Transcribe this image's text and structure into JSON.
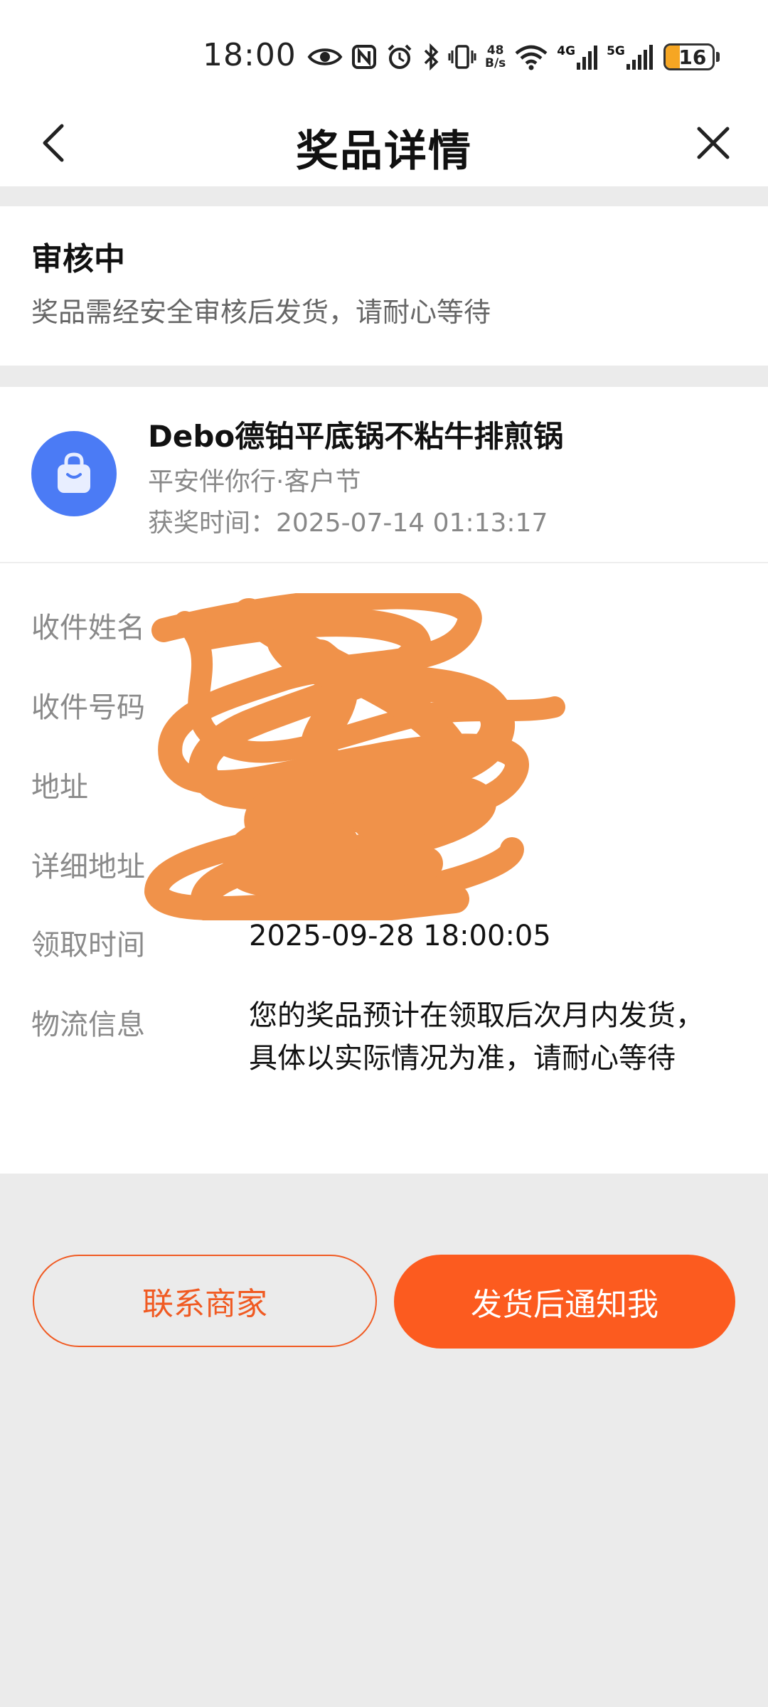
{
  "status_bar": {
    "time": "18:00",
    "net_speed_value": "48",
    "net_speed_unit": "B/s",
    "sim1_label": "4G",
    "sim2_label": "5G",
    "battery": "16"
  },
  "nav": {
    "title": "奖品详情"
  },
  "review": {
    "title": "审核中",
    "description": "奖品需经安全审核后发货，请耐心等待"
  },
  "prize": {
    "name": "Debo德铂平底锅不粘牛排煎锅",
    "activity": "平安伴你行·客户节",
    "award_time": "获奖时间：2025-07-14 01:13:17"
  },
  "fields": {
    "recipient_name_label": "收件姓名",
    "recipient_phone_label": "收件号码",
    "address_label": "地址",
    "detail_address_label": "详细地址",
    "claim_time_label": "领取时间",
    "claim_time_value": "2025-09-28 18:00:05",
    "logistics_label": "物流信息",
    "logistics_value": "您的奖品预计在领取后次月内发货，具体以实际情况为准，请耐心等待"
  },
  "actions": {
    "contact_label": "联系商家",
    "notify_label": "发货后通知我"
  },
  "colors": {
    "accent": "#fc5b1f",
    "icon_bg": "#4b7bf5",
    "redaction": "#f0924a"
  }
}
